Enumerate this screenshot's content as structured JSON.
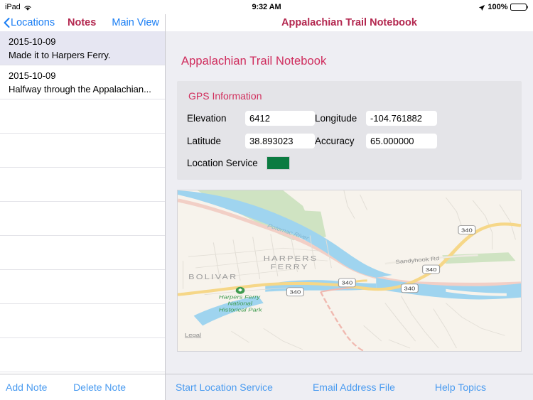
{
  "statusbar": {
    "device": "iPad",
    "wifi_icon": "wifi-icon",
    "time": "9:32 AM",
    "location_icon": "location-arrow-icon",
    "battery_percent": "100%",
    "battery_icon": "battery-full-icon"
  },
  "left_pane": {
    "navbar": {
      "back_label": "Locations",
      "back_icon": "chevron-left-icon",
      "title": "Notes",
      "right_label": "Main View"
    },
    "notes": [
      {
        "date": "2015-10-09",
        "text": "Made it to Harpers Ferry.",
        "selected": true
      },
      {
        "date": "2015-10-09",
        "text": "Halfway through the Appalachian...",
        "selected": false
      }
    ],
    "empty_row_count": 8,
    "toolbar": {
      "add_label": "Add Note",
      "delete_label": "Delete Note"
    }
  },
  "right_pane": {
    "navbar": {
      "title": "Appalachian Trail Notebook"
    },
    "detail_title": "Appalachian Trail Notebook",
    "gps": {
      "heading": "GPS Information",
      "fields": [
        {
          "label": "Elevation",
          "value": "6412"
        },
        {
          "label": "Longitude",
          "value": "-104.761882"
        },
        {
          "label": "Latitude",
          "value": "38.893023"
        },
        {
          "label": "Accuracy",
          "value": "65.000000"
        }
      ],
      "location_service_label": "Location Service",
      "location_service_color": "#0b7b41"
    },
    "map": {
      "river_label": "Potomac River",
      "city_labels": [
        "HARPERS",
        "FERRY",
        "BOLIVAR"
      ],
      "road_label": "Sandyhook Rd",
      "park_label_lines": [
        "Harpers Ferry",
        "National",
        "Historical Park"
      ],
      "route_shields": [
        "340",
        "340",
        "340",
        "340",
        "340"
      ],
      "legal_label": "Legal",
      "water_color": "#9fd4ef",
      "land_color": "#f7f3ec",
      "highway_color": "#f6d788",
      "green_color": "#cfe3c2"
    },
    "toolbar": {
      "start_location_label": "Start Location Service",
      "email_label": "Email Address File",
      "help_label": "Help Topics"
    }
  }
}
